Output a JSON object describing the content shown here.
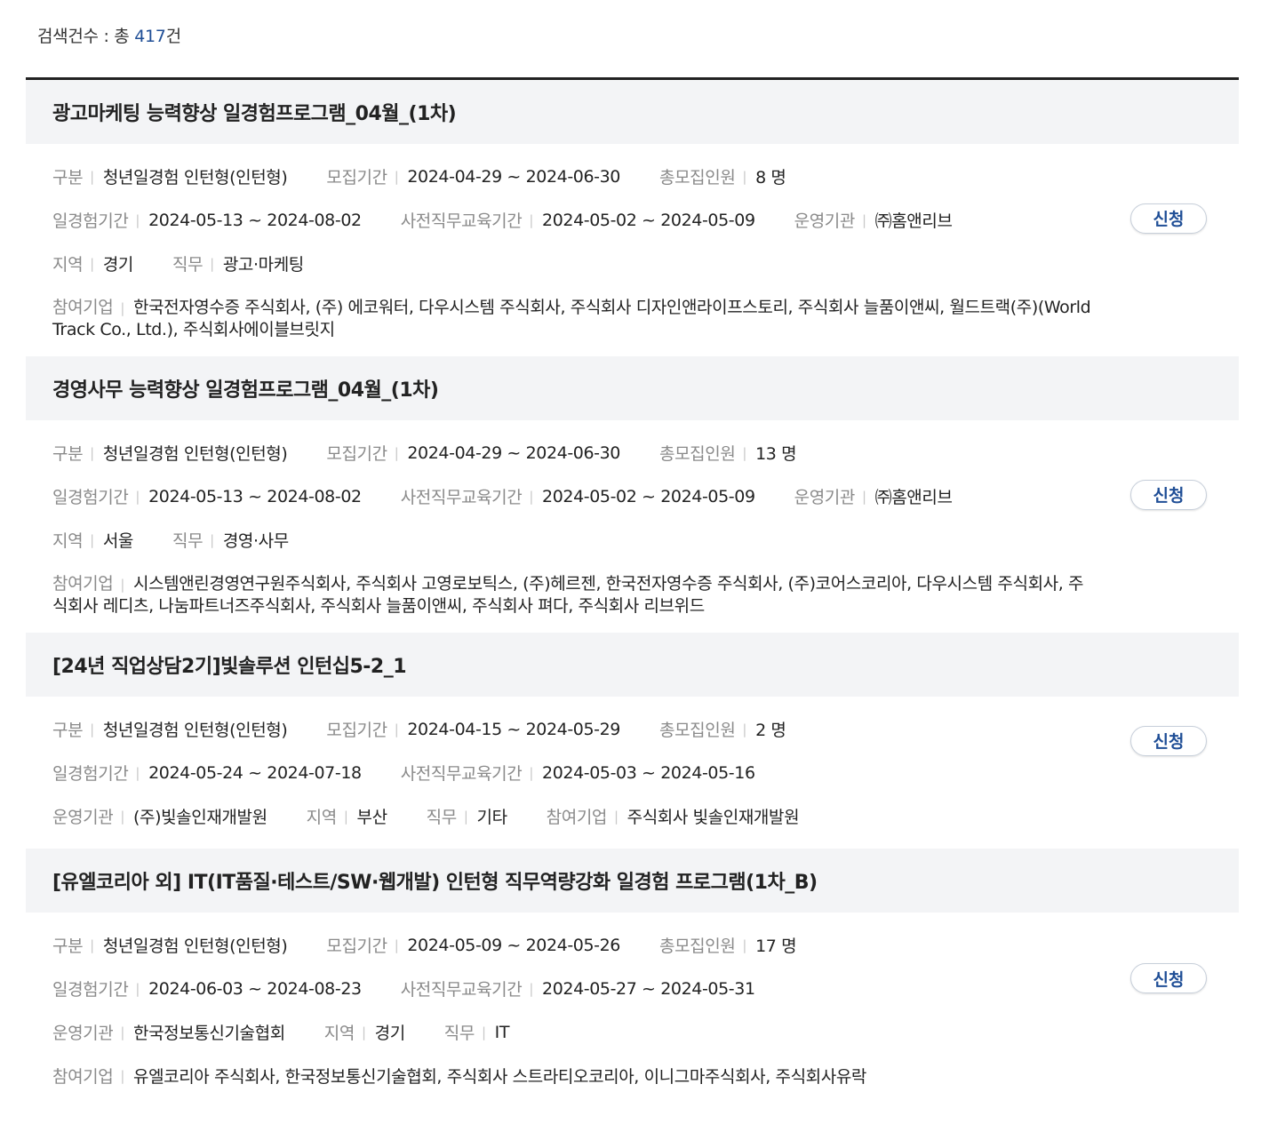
{
  "summary": {
    "label": "검색건수 : 총 ",
    "count": "417",
    "unit": "건"
  },
  "labels": {
    "category": "구분",
    "recruit_period": "모집기간",
    "total_recruit": "총모집인원",
    "exp_period": "일경험기간",
    "pre_edu_period": "사전직무교육기간",
    "operator": "운영기관",
    "region": "지역",
    "job": "직무",
    "companies": "참여기업",
    "apply": "신청"
  },
  "programs": [
    {
      "title": "광고마케팅 능력향상 일경험프로그램_04월_(1차)",
      "category": "청년일경험 인턴형(인턴형)",
      "recruit_period": "2024-04-29 ~ 2024-06-30",
      "total_recruit": "8 명",
      "exp_period": "2024-05-13 ~ 2024-08-02",
      "pre_edu_period": "2024-05-02 ~ 2024-05-09",
      "operator": "㈜홈앤리브",
      "region": "경기",
      "job": "광고·마케팅",
      "companies": "한국전자영수증 주식회사, (주) 에코워터, 다우시스템 주식회사, 주식회사 디자인앤라이프스토리, 주식회사 늘품이앤씨, 월드트랙(주)(World Track Co., Ltd.), 주식회사에이블브릿지"
    },
    {
      "title": "경영사무 능력향상 일경험프로그램_04월_(1차)",
      "category": "청년일경험 인턴형(인턴형)",
      "recruit_period": "2024-04-29 ~ 2024-06-30",
      "total_recruit": "13 명",
      "exp_period": "2024-05-13 ~ 2024-08-02",
      "pre_edu_period": "2024-05-02 ~ 2024-05-09",
      "operator": "㈜홈앤리브",
      "region": "서울",
      "job": "경영·사무",
      "companies": "시스템앤린경영연구원주식회사, 주식회사 고영로보틱스, (주)헤르젠, 한국전자영수증 주식회사, (주)코어스코리아, 다우시스템 주식회사, 주식회사 레디츠, 나눔파트너즈주식회사, 주식회사 늘품이앤씨, 주식회사 펴다, 주식회사 리브위드"
    },
    {
      "title": "[24년 직업상담2기]빛솔루션 인턴십5-2_1",
      "category": "청년일경험 인턴형(인턴형)",
      "recruit_period": "2024-04-15 ~ 2024-05-29",
      "total_recruit": "2 명",
      "exp_period": "2024-05-24 ~ 2024-07-18",
      "pre_edu_period": "2024-05-03 ~ 2024-05-16",
      "operator": "(주)빛솔인재개발원",
      "region": "부산",
      "job": "기타",
      "companies": "주식회사 빛솔인재개발원"
    },
    {
      "title": "[유엘코리아 외] IT(IT품질·테스트/SW·웹개발) 인턴형 직무역량강화 일경험 프로그램(1차_B)",
      "category": "청년일경험 인턴형(인턴형)",
      "recruit_period": "2024-05-09 ~ 2024-05-26",
      "total_recruit": "17 명",
      "exp_period": "2024-06-03 ~ 2024-08-23",
      "pre_edu_period": "2024-05-27 ~ 2024-05-31",
      "operator": "한국정보통신기술협회",
      "region": "경기",
      "job": "IT",
      "companies": "유엘코리아 주식회사, 한국정보통신기술협회, 주식회사 스트라티오코리아, 이니그마주식회사, 주식회사유락"
    }
  ]
}
